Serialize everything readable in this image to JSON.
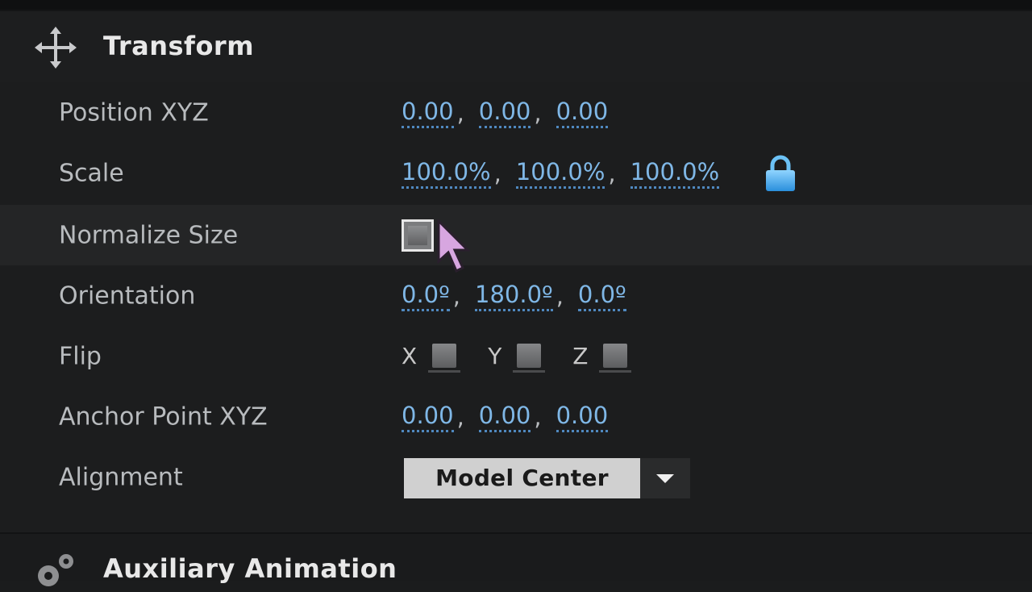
{
  "transform": {
    "title": "Transform",
    "icon": "move-arrows-icon",
    "rows": {
      "position": {
        "label": "Position XYZ",
        "values": [
          "0.00",
          "0.00",
          "0.00"
        ]
      },
      "scale": {
        "label": "Scale",
        "values": [
          "100.0%",
          "100.0%",
          "100.0%"
        ],
        "lock_icon": "lock-icon"
      },
      "normalize": {
        "label": "Normalize Size",
        "checked": false
      },
      "orientation": {
        "label": "Orientation",
        "values": [
          "0.0º",
          "180.0º",
          "0.0º"
        ]
      },
      "flip": {
        "label": "Flip",
        "axes": [
          "X",
          "Y",
          "Z"
        ]
      },
      "anchor": {
        "label": "Anchor Point XYZ",
        "values": [
          "0.00",
          "0.00",
          "0.00"
        ]
      },
      "alignment": {
        "label": "Alignment",
        "selected": "Model Center"
      }
    },
    "separator": ","
  },
  "auxiliary": {
    "title": "Auxiliary Animation",
    "icon": "gears-icon"
  },
  "colors": {
    "value_text": "#7fb7e6",
    "lock": "#3fa8f0"
  }
}
